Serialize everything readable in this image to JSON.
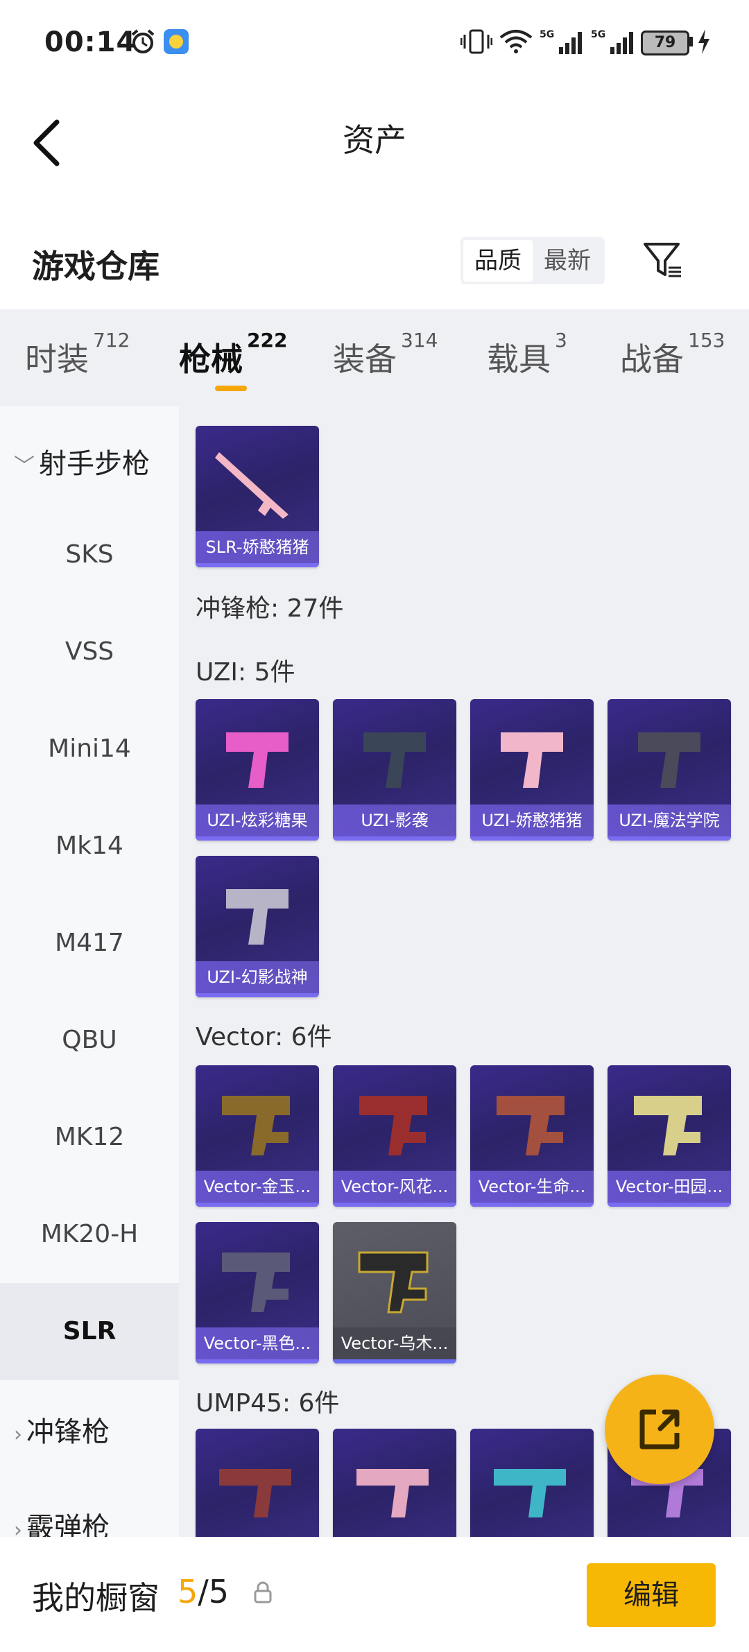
{
  "status": {
    "time": "00:14",
    "battery": "79",
    "signal1": "5G",
    "signal2": "5G"
  },
  "header": {
    "title": "资产"
  },
  "section": {
    "title": "游戏仓库",
    "sort_quality": "品质",
    "sort_newest": "最新"
  },
  "tabs": [
    {
      "label": "时装",
      "count": "712"
    },
    {
      "label": "枪械",
      "count": "222"
    },
    {
      "label": "装备",
      "count": "314"
    },
    {
      "label": "载具",
      "count": "3"
    },
    {
      "label": "战备",
      "count": "153"
    }
  ],
  "sidebar": {
    "group1": "射手步枪",
    "items": [
      "SKS",
      "VSS",
      "Mini14",
      "Mk14",
      "M417",
      "QBU",
      "MK12",
      "MK20-H",
      "SLR"
    ],
    "group2": "冲锋枪",
    "group3": "霰弹枪"
  },
  "content": {
    "slr_items": [
      "SLR-娇憨猪猪"
    ],
    "smg_header": "冲锋枪: 27件",
    "uzi_header": "UZI: 5件",
    "uzi_items": [
      "UZI-炫彩糖果",
      "UZI-影袭",
      "UZI-娇憨猪猪",
      "UZI-魔法学院",
      "UZI-幻影战神"
    ],
    "vector_header": "Vector: 6件",
    "vector_items": [
      "Vector-金玉...",
      "Vector-风花...",
      "Vector-生命...",
      "Vector-田园...",
      "Vector-黑色...",
      "Vector-乌木..."
    ],
    "ump_header": "UMP45: 6件"
  },
  "bottom": {
    "label": "我的橱窗",
    "count_current": "5",
    "count_sep": "/",
    "count_total": "5",
    "edit_label": "编辑"
  },
  "colors": {
    "accent": "#f5a70a",
    "card_bg": "#2c2368",
    "fab": "#f5b317"
  }
}
